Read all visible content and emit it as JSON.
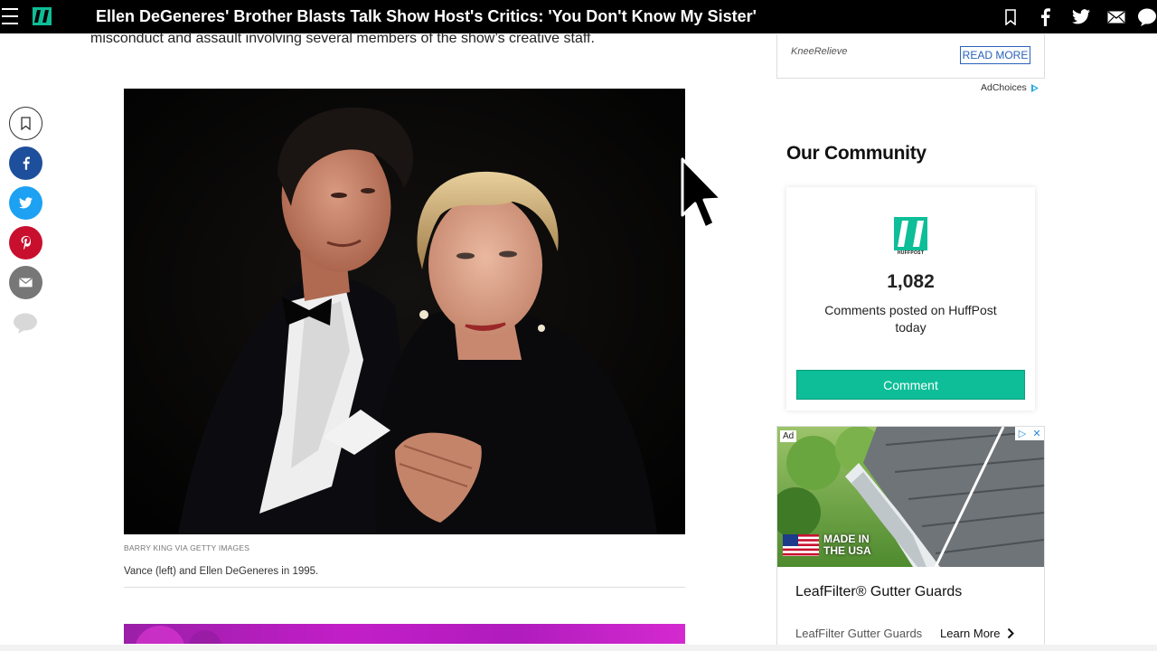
{
  "header": {
    "title": "Ellen DeGeneres' Brother Blasts Talk Show Host's Critics: 'You Don't Know My Sister'"
  },
  "article": {
    "lead_text": "misconduct and assault involving several members of the show’s creative staff.",
    "photo_credit": "BARRY KING VIA GETTY IMAGES",
    "photo_caption": "Vance (left) and Ellen DeGeneres in 1995."
  },
  "sidebar": {
    "top_ad": {
      "brand": "KneeRelieve",
      "cta": "READ MORE"
    },
    "adchoices": "AdChoices",
    "community": {
      "title": "Our Community",
      "logo_word": "HUFFPOST",
      "count": "1,082",
      "count_label": "Comments posted on HuffPost today",
      "button": "Comment"
    },
    "bottom_ad": {
      "tag": "Ad",
      "made_in_line1": "MADE IN",
      "made_in_line2": "THE USA",
      "headline": "LeafFilter® Gutter Guards",
      "source": "LeafFilter Gutter Guards",
      "cta": "Learn More"
    }
  },
  "colors": {
    "brand_green": "#0dbe98",
    "facebook": "#1e4f9c",
    "twitter": "#1da1f2",
    "pinterest": "#c8102e",
    "link_blue": "#2a62b8"
  },
  "icons": {
    "menu": "hamburger-icon",
    "logo": "huffpost-logo",
    "top_bar": [
      "bookmark-icon",
      "facebook-icon",
      "twitter-icon",
      "mail-icon",
      "comment-icon"
    ],
    "share_rail": [
      "bookmark-icon",
      "facebook-icon",
      "twitter-icon",
      "pinterest-icon",
      "mail-icon",
      "comment-icon"
    ]
  }
}
